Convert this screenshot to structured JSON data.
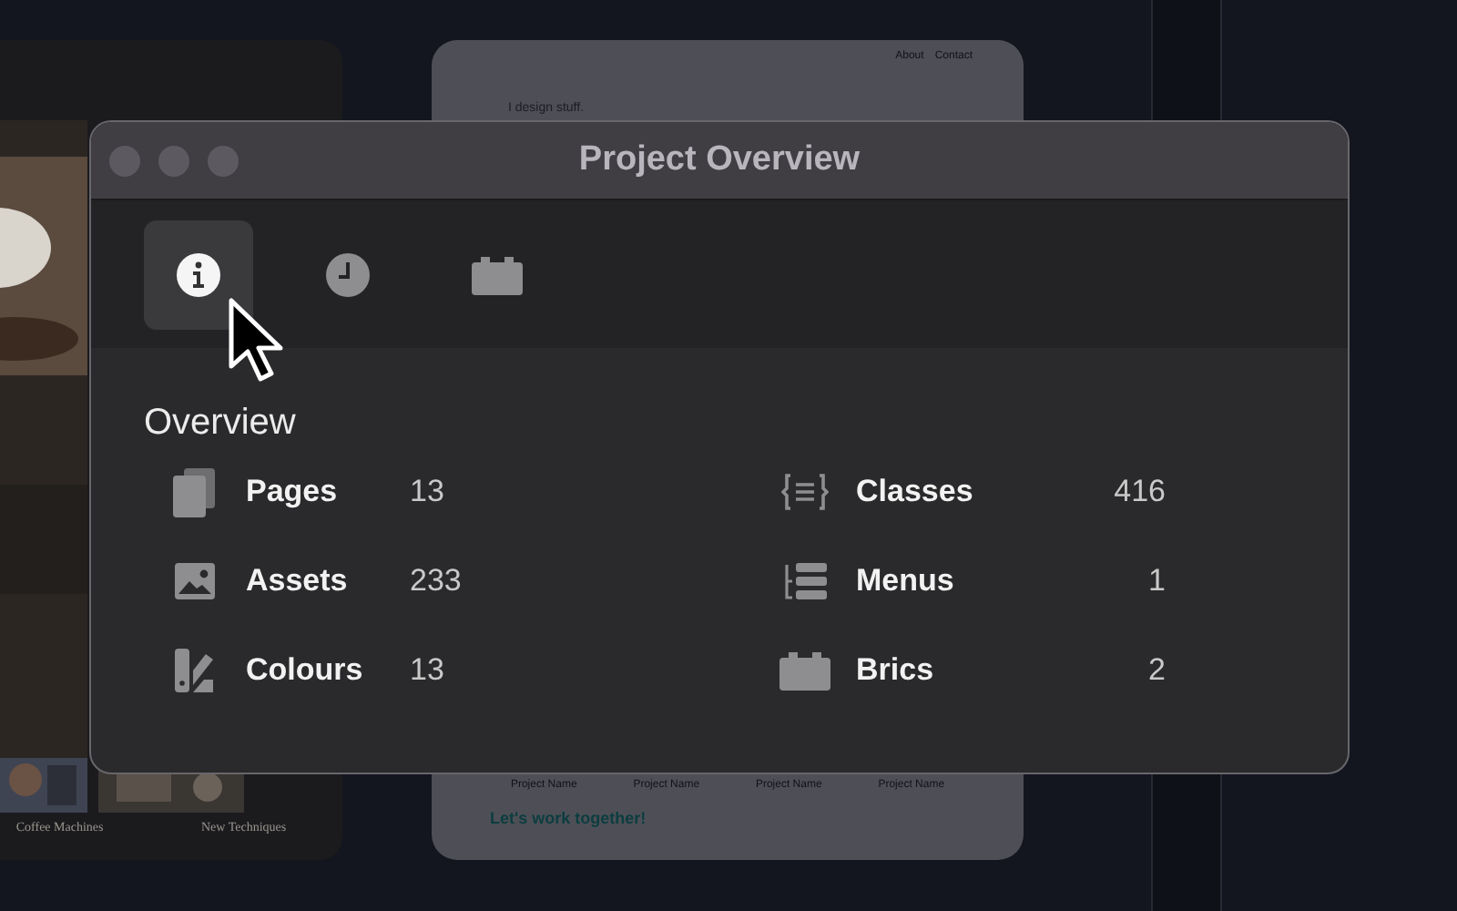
{
  "background": {
    "left_card": {
      "kind": "picture",
      "captions": [
        "Coffee Machines",
        "New Techniques"
      ]
    },
    "right_card": {
      "nav": [
        "About",
        "Contact"
      ],
      "headline": "I design stuff.",
      "projects": [
        "Project Name",
        "Project Name",
        "Project Name",
        "Project Name"
      ],
      "cta": "Let's work together!"
    }
  },
  "window": {
    "title": "Project Overview"
  },
  "tabs": [
    {
      "kind": "info",
      "selected": true
    },
    {
      "kind": "history",
      "selected": false
    },
    {
      "kind": "brics",
      "selected": false
    }
  ],
  "section": {
    "title": "Overview"
  },
  "columns": [
    {
      "items": [
        {
          "kind": "pages",
          "label": "Pages",
          "value": "13"
        },
        {
          "kind": "assets",
          "label": "Assets",
          "value": "233"
        },
        {
          "kind": "colours",
          "label": "Colours",
          "value": "13"
        }
      ]
    },
    {
      "items": [
        {
          "kind": "classes",
          "label": "Classes",
          "value": "416"
        },
        {
          "kind": "menus",
          "label": "Menus",
          "value": "1"
        },
        {
          "kind": "brics",
          "label": "Brics",
          "value": "2"
        }
      ]
    }
  ]
}
